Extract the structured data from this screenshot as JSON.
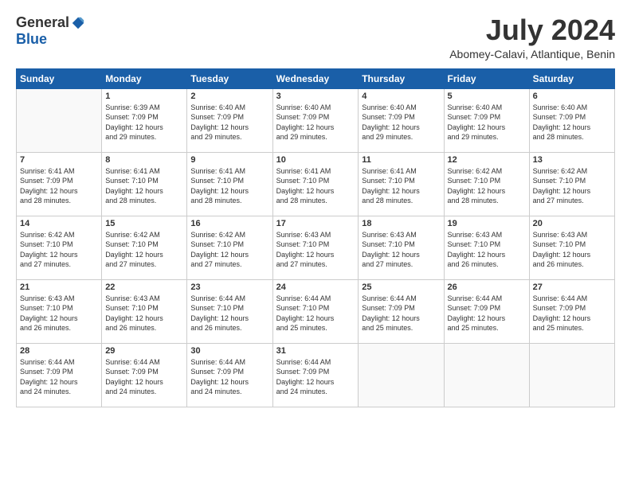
{
  "logo": {
    "general": "General",
    "blue": "Blue"
  },
  "header": {
    "month": "July 2024",
    "location": "Abomey-Calavi, Atlantique, Benin"
  },
  "weekdays": [
    "Sunday",
    "Monday",
    "Tuesday",
    "Wednesday",
    "Thursday",
    "Friday",
    "Saturday"
  ],
  "weeks": [
    [
      {
        "day": "",
        "info": ""
      },
      {
        "day": "1",
        "info": "Sunrise: 6:39 AM\nSunset: 7:09 PM\nDaylight: 12 hours\nand 29 minutes."
      },
      {
        "day": "2",
        "info": "Sunrise: 6:40 AM\nSunset: 7:09 PM\nDaylight: 12 hours\nand 29 minutes."
      },
      {
        "day": "3",
        "info": "Sunrise: 6:40 AM\nSunset: 7:09 PM\nDaylight: 12 hours\nand 29 minutes."
      },
      {
        "day": "4",
        "info": "Sunrise: 6:40 AM\nSunset: 7:09 PM\nDaylight: 12 hours\nand 29 minutes."
      },
      {
        "day": "5",
        "info": "Sunrise: 6:40 AM\nSunset: 7:09 PM\nDaylight: 12 hours\nand 29 minutes."
      },
      {
        "day": "6",
        "info": "Sunrise: 6:40 AM\nSunset: 7:09 PM\nDaylight: 12 hours\nand 28 minutes."
      }
    ],
    [
      {
        "day": "7",
        "info": "Sunrise: 6:41 AM\nSunset: 7:09 PM\nDaylight: 12 hours\nand 28 minutes."
      },
      {
        "day": "8",
        "info": "Sunrise: 6:41 AM\nSunset: 7:10 PM\nDaylight: 12 hours\nand 28 minutes."
      },
      {
        "day": "9",
        "info": "Sunrise: 6:41 AM\nSunset: 7:10 PM\nDaylight: 12 hours\nand 28 minutes."
      },
      {
        "day": "10",
        "info": "Sunrise: 6:41 AM\nSunset: 7:10 PM\nDaylight: 12 hours\nand 28 minutes."
      },
      {
        "day": "11",
        "info": "Sunrise: 6:41 AM\nSunset: 7:10 PM\nDaylight: 12 hours\nand 28 minutes."
      },
      {
        "day": "12",
        "info": "Sunrise: 6:42 AM\nSunset: 7:10 PM\nDaylight: 12 hours\nand 28 minutes."
      },
      {
        "day": "13",
        "info": "Sunrise: 6:42 AM\nSunset: 7:10 PM\nDaylight: 12 hours\nand 27 minutes."
      }
    ],
    [
      {
        "day": "14",
        "info": "Sunrise: 6:42 AM\nSunset: 7:10 PM\nDaylight: 12 hours\nand 27 minutes."
      },
      {
        "day": "15",
        "info": "Sunrise: 6:42 AM\nSunset: 7:10 PM\nDaylight: 12 hours\nand 27 minutes."
      },
      {
        "day": "16",
        "info": "Sunrise: 6:42 AM\nSunset: 7:10 PM\nDaylight: 12 hours\nand 27 minutes."
      },
      {
        "day": "17",
        "info": "Sunrise: 6:43 AM\nSunset: 7:10 PM\nDaylight: 12 hours\nand 27 minutes."
      },
      {
        "day": "18",
        "info": "Sunrise: 6:43 AM\nSunset: 7:10 PM\nDaylight: 12 hours\nand 27 minutes."
      },
      {
        "day": "19",
        "info": "Sunrise: 6:43 AM\nSunset: 7:10 PM\nDaylight: 12 hours\nand 26 minutes."
      },
      {
        "day": "20",
        "info": "Sunrise: 6:43 AM\nSunset: 7:10 PM\nDaylight: 12 hours\nand 26 minutes."
      }
    ],
    [
      {
        "day": "21",
        "info": "Sunrise: 6:43 AM\nSunset: 7:10 PM\nDaylight: 12 hours\nand 26 minutes."
      },
      {
        "day": "22",
        "info": "Sunrise: 6:43 AM\nSunset: 7:10 PM\nDaylight: 12 hours\nand 26 minutes."
      },
      {
        "day": "23",
        "info": "Sunrise: 6:44 AM\nSunset: 7:10 PM\nDaylight: 12 hours\nand 26 minutes."
      },
      {
        "day": "24",
        "info": "Sunrise: 6:44 AM\nSunset: 7:10 PM\nDaylight: 12 hours\nand 25 minutes."
      },
      {
        "day": "25",
        "info": "Sunrise: 6:44 AM\nSunset: 7:09 PM\nDaylight: 12 hours\nand 25 minutes."
      },
      {
        "day": "26",
        "info": "Sunrise: 6:44 AM\nSunset: 7:09 PM\nDaylight: 12 hours\nand 25 minutes."
      },
      {
        "day": "27",
        "info": "Sunrise: 6:44 AM\nSunset: 7:09 PM\nDaylight: 12 hours\nand 25 minutes."
      }
    ],
    [
      {
        "day": "28",
        "info": "Sunrise: 6:44 AM\nSunset: 7:09 PM\nDaylight: 12 hours\nand 24 minutes."
      },
      {
        "day": "29",
        "info": "Sunrise: 6:44 AM\nSunset: 7:09 PM\nDaylight: 12 hours\nand 24 minutes."
      },
      {
        "day": "30",
        "info": "Sunrise: 6:44 AM\nSunset: 7:09 PM\nDaylight: 12 hours\nand 24 minutes."
      },
      {
        "day": "31",
        "info": "Sunrise: 6:44 AM\nSunset: 7:09 PM\nDaylight: 12 hours\nand 24 minutes."
      },
      {
        "day": "",
        "info": ""
      },
      {
        "day": "",
        "info": ""
      },
      {
        "day": "",
        "info": ""
      }
    ]
  ]
}
